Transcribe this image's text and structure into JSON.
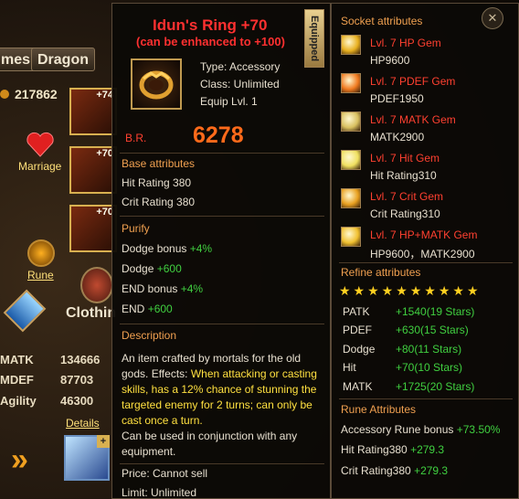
{
  "background": {
    "tabs": [
      "mes",
      "Dragon"
    ],
    "power": "217862",
    "slot_tags": [
      "+74",
      "+70",
      "+70"
    ],
    "marriage_label": "Marriage",
    "rune_label": "Rune",
    "clothing_label": "Clothin",
    "stats": [
      {
        "label": "MATK",
        "value": "134666"
      },
      {
        "label": "MDEF",
        "value": "87703"
      },
      {
        "label": "Agility",
        "value": "46300"
      }
    ],
    "details_link": "Details",
    "arrow": "»"
  },
  "item": {
    "title": "Idun's Ring  +70",
    "subtitle": "(can be enhanced to +100)",
    "equipped_label": "Equipped",
    "type": "Type: Accessory",
    "class": "Class: Unlimited",
    "equip_lvl": "Equip Lvl. 1",
    "br_label": "B.R.",
    "br_value": "6278",
    "base_head": "Base attributes",
    "base": [
      "Hit Rating 380",
      "Crit Rating 380"
    ],
    "purify_head": "Purify",
    "purify": [
      {
        "name": "Dodge bonus",
        "value": "+4%"
      },
      {
        "name": "Dodge",
        "value": "+600"
      },
      {
        "name": "END bonus",
        "value": "+4%"
      },
      {
        "name": "END",
        "value": "+600"
      }
    ],
    "desc_head": "Description",
    "desc_a": "An item crafted by mortals for the old gods. Effects: ",
    "desc_b": "When attacking or casting skills, has a 12% chance of stunning the targeted enemy for 2 turns; can only be cast once a turn.",
    "desc_c": " Can be used in conjunction with any equipment.",
    "price": "Price: Cannot sell",
    "limit": "Limit: Unlimited"
  },
  "socket": {
    "head": "Socket attributes",
    "close_icon": "✕",
    "gems": [
      {
        "name": "Lvl. 7 HP Gem",
        "value": "HP9600",
        "color": "#e8b020"
      },
      {
        "name": "Lvl. 7 PDEF Gem",
        "value": "PDEF1950",
        "color": "#f07a20"
      },
      {
        "name": "Lvl. 7 MATK Gem",
        "value": "MATK2900",
        "color": "#d8c060"
      },
      {
        "name": "Lvl. 7 Hit Gem",
        "value": "Hit Rating310",
        "color": "#f0e060"
      },
      {
        "name": "Lvl. 7 Crit Gem",
        "value": "Crit Rating310",
        "color": "#e8a020"
      },
      {
        "name": "Lvl. 7 HP+MATK Gem",
        "value": "HP9600，MATK2900",
        "color": "#f0c030"
      }
    ],
    "refine_head": "Refine attributes",
    "stars": "★★★★★★★★★★",
    "refine": [
      {
        "name": "PATK",
        "value": "+1540(19 Stars)"
      },
      {
        "name": "PDEF",
        "value": "+630(15 Stars)"
      },
      {
        "name": "Dodge",
        "value": "+80(11 Stars)"
      },
      {
        "name": "Hit",
        "value": "+70(10 Stars)"
      },
      {
        "name": "MATK",
        "value": "+1725(20 Stars)"
      }
    ],
    "rune_head": "Rune Attributes",
    "rune": [
      {
        "name": "Accessory Rune bonus",
        "value": "+73.50%"
      },
      {
        "name": "Hit Rating380",
        "value": "+279.3"
      },
      {
        "name": "Crit Rating380",
        "value": "+279.3"
      }
    ]
  }
}
